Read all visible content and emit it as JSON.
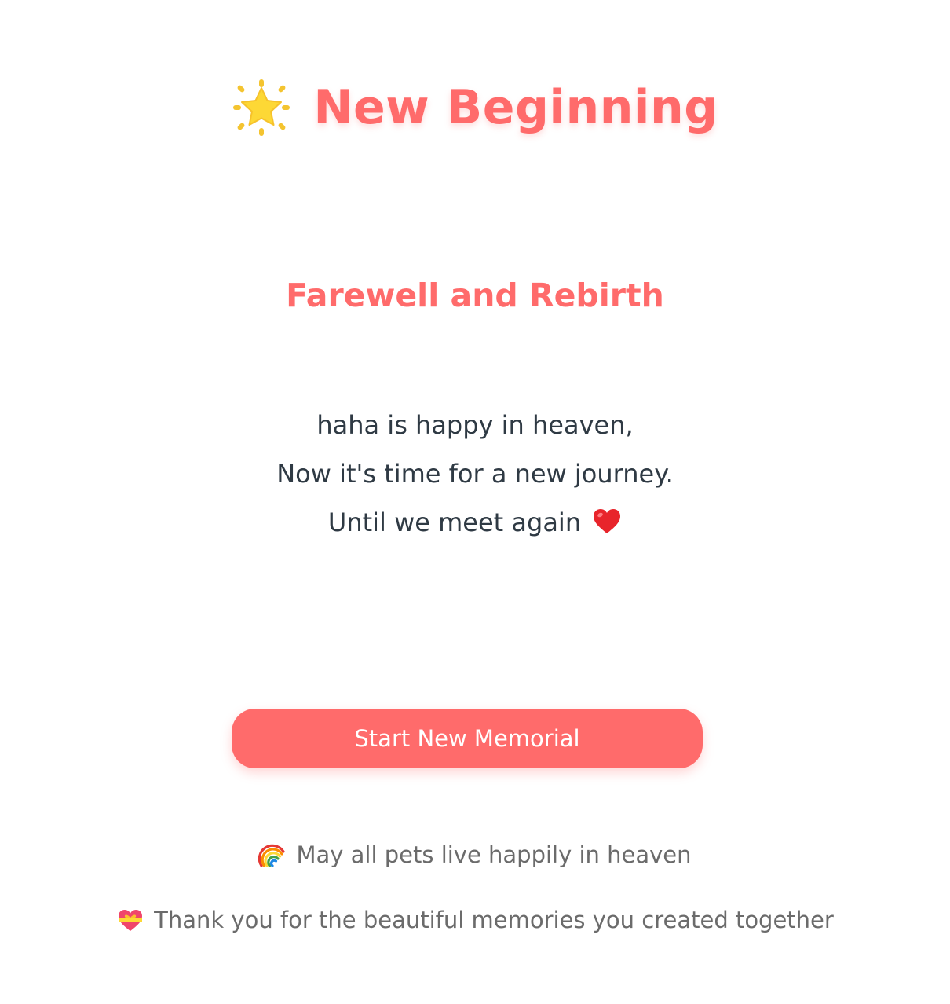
{
  "header": {
    "icon": "sparkle-star-icon",
    "title": "New Beginning"
  },
  "section": {
    "heading": "Farewell and Rebirth"
  },
  "message": {
    "lines": [
      "haha is happy in heaven,",
      "Now it's time for a new journey.",
      "Until we meet again"
    ],
    "closing_icon": "red-heart-icon"
  },
  "actions": {
    "start_button_label": "Start New Memorial"
  },
  "footer": {
    "line1": {
      "icon": "rainbow-icon",
      "text": "May all pets live happily in heaven"
    },
    "line2": {
      "icon": "gift-heart-icon",
      "text": "Thank you for the beautiful memories you created together"
    }
  },
  "colors": {
    "accent": "#ff6b6b",
    "body_text": "#2f3a44",
    "muted_text": "#6b6b6b",
    "background": "#ffffff"
  }
}
